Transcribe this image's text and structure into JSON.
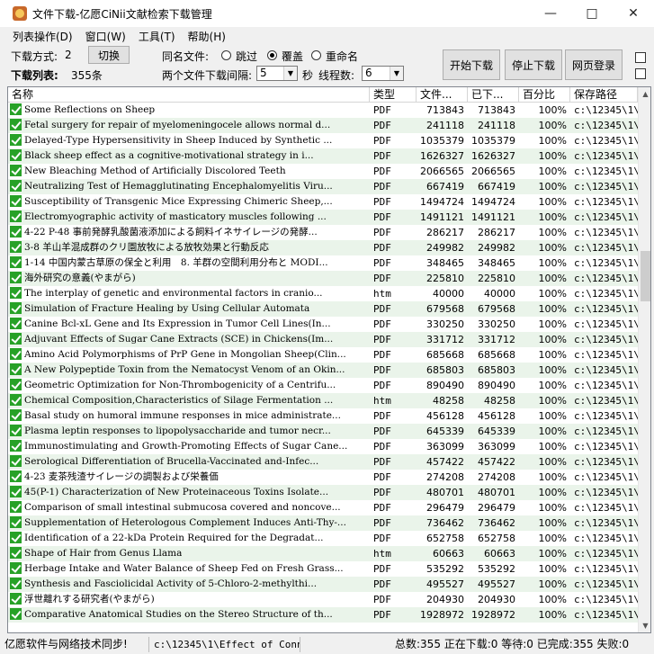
{
  "window": {
    "title": "文件下载-亿愿CiNii文献检索下载管理"
  },
  "menu": [
    "列表操作(D)",
    "窗口(W)",
    "工具(T)",
    "帮助(H)"
  ],
  "toolbar": {
    "download_mode_label": "下载方式:",
    "download_mode_value": "2",
    "switch_button": "切换",
    "download_list_label": "下载列表:",
    "download_list_count": "355条",
    "same_name_label": "同名文件:",
    "opt_skip": "跳过",
    "opt_overwrite": "覆盖",
    "opt_rename": "重命名",
    "interval_label": "两个文件下载间隔:",
    "interval_value": "5",
    "interval_unit": "秒",
    "threads_label": "线程数:",
    "threads_value": "6",
    "start_button": "开始下载",
    "stop_button": "停止下载",
    "login_button": "网页登录"
  },
  "columns": [
    "名称",
    "类型",
    "文件...",
    "已下...",
    "百分比",
    "保存路径"
  ],
  "rows": [
    [
      "Some Reflections on Sheep",
      "PDF",
      "713843",
      "713843",
      "100%",
      "c:\\12345\\1\\"
    ],
    [
      "Fetal surgery for repair of myelomeningocele allows normal d...",
      "PDF",
      "241118",
      "241118",
      "100%",
      "c:\\12345\\1\\"
    ],
    [
      "Delayed-Type Hypersensitivity in Sheep Induced by Synthetic ...",
      "PDF",
      "1035379",
      "1035379",
      "100%",
      "c:\\12345\\1\\"
    ],
    [
      "Black sheep effect as a cognitive-motivational strategy in i...",
      "PDF",
      "1626327",
      "1626327",
      "100%",
      "c:\\12345\\1\\"
    ],
    [
      "New Bleaching Method of Artificially Discolored Teeth",
      "PDF",
      "2066565",
      "2066565",
      "100%",
      "c:\\12345\\1\\"
    ],
    [
      "Neutralizing Test of Hemagglutinating Encephalomyelitis Viru...",
      "PDF",
      "667419",
      "667419",
      "100%",
      "c:\\12345\\1\\"
    ],
    [
      "Susceptibility of Transgenic Mice Expressing Chimeric Sheep,...",
      "PDF",
      "1494724",
      "1494724",
      "100%",
      "c:\\12345\\1\\"
    ],
    [
      "Electromyographic activity of masticatory muscles following ...",
      "PDF",
      "1491121",
      "1491121",
      "100%",
      "c:\\12345\\1\\"
    ],
    [
      "4-22 P-48 事前発酵乳酸菌液添加による飼料イネサイレージの発酵...",
      "PDF",
      "286217",
      "286217",
      "100%",
      "c:\\12345\\1\\"
    ],
    [
      "3-8 羊山羊混成群のクリ園放牧による放牧効果と行動反応",
      "PDF",
      "249982",
      "249982",
      "100%",
      "c:\\12345\\1\\"
    ],
    [
      "1-14 中国内蒙古草原の保全と利用　8. 羊群の空間利用分布と MODI...",
      "PDF",
      "348465",
      "348465",
      "100%",
      "c:\\12345\\1\\"
    ],
    [
      "海外研究の意義(やまがら)",
      "PDF",
      "225810",
      "225810",
      "100%",
      "c:\\12345\\1\\"
    ],
    [
      "The interplay of genetic and environmental factors in cranio...",
      "htm",
      "40000",
      "40000",
      "100%",
      "c:\\12345\\1\\"
    ],
    [
      "Simulation of Fracture Healing by Using Cellular Automata",
      "PDF",
      "679568",
      "679568",
      "100%",
      "c:\\12345\\1\\"
    ],
    [
      "Canine Bcl-xL Gene and Its Expression in Tumor Cell Lines(In...",
      "PDF",
      "330250",
      "330250",
      "100%",
      "c:\\12345\\1\\"
    ],
    [
      "Adjuvant Effects of Sugar Cane Extracts (SCE) in Chickens(Im...",
      "PDF",
      "331712",
      "331712",
      "100%",
      "c:\\12345\\1\\"
    ],
    [
      "Amino Acid Polymorphisms of PrP Gene in Mongolian Sheep(Clin...",
      "PDF",
      "685668",
      "685668",
      "100%",
      "c:\\12345\\1\\"
    ],
    [
      "A New Polypeptide Toxin from the Nematocyst Venom of an Okin...",
      "PDF",
      "685803",
      "685803",
      "100%",
      "c:\\12345\\1\\"
    ],
    [
      "Geometric Optimization for Non-Thrombogenicity of a Centrifu...",
      "PDF",
      "890490",
      "890490",
      "100%",
      "c:\\12345\\1\\"
    ],
    [
      "Chemical Composition,Characteristics of Silage Fermentation ...",
      "htm",
      "48258",
      "48258",
      "100%",
      "c:\\12345\\1\\"
    ],
    [
      "Basal study on humoral immune responses in mice administrate...",
      "PDF",
      "456128",
      "456128",
      "100%",
      "c:\\12345\\1\\"
    ],
    [
      "Plasma leptin responses to lipopolysaccharide and tumor necr...",
      "PDF",
      "645339",
      "645339",
      "100%",
      "c:\\12345\\1\\"
    ],
    [
      "Immunostimulating and Growth-Promoting Effects of Sugar Cane...",
      "PDF",
      "363099",
      "363099",
      "100%",
      "c:\\12345\\1\\"
    ],
    [
      "Serological Differentiation of Brucella-Vaccinated and-Infec...",
      "PDF",
      "457422",
      "457422",
      "100%",
      "c:\\12345\\1\\"
    ],
    [
      "4-23 麦茶残渣サイレージの調製および栄養価",
      "PDF",
      "274208",
      "274208",
      "100%",
      "c:\\12345\\1\\"
    ],
    [
      "45(P-1) Characterization of New Proteinaceous Toxins Isolate...",
      "PDF",
      "480701",
      "480701",
      "100%",
      "c:\\12345\\1\\"
    ],
    [
      "Comparison of small intestinal submucosa covered and noncove...",
      "PDF",
      "296479",
      "296479",
      "100%",
      "c:\\12345\\1\\"
    ],
    [
      "Supplementation of Heterologous Complement Induces Anti-Thy-...",
      "PDF",
      "736462",
      "736462",
      "100%",
      "c:\\12345\\1\\"
    ],
    [
      "Identification of a 22-kDa Protein Required for the Degradat...",
      "PDF",
      "652758",
      "652758",
      "100%",
      "c:\\12345\\1\\"
    ],
    [
      "Shape of Hair from Genus Llama",
      "htm",
      "60663",
      "60663",
      "100%",
      "c:\\12345\\1\\"
    ],
    [
      "Herbage Intake and Water Balance of Sheep Fed on Fresh Grass...",
      "PDF",
      "535292",
      "535292",
      "100%",
      "c:\\12345\\1\\"
    ],
    [
      "Synthesis and Fasciolicidal Activity of 5-Chloro-2-methylthi...",
      "PDF",
      "495527",
      "495527",
      "100%",
      "c:\\12345\\1\\"
    ],
    [
      "浮世離れする研究者(やまがら)",
      "PDF",
      "204930",
      "204930",
      "100%",
      "c:\\12345\\1\\"
    ],
    [
      "Comparative Anatomical Studies on the Stereo Structure of th...",
      "PDF",
      "1928972",
      "1928972",
      "100%",
      "c:\\12345\\1\\"
    ]
  ],
  "status": {
    "company": "亿愿软件与网络技术同步!",
    "current_path": "c:\\12345\\1\\Effect of Conne",
    "summary": "总数:355 正在下载:0 等待:0 已完成:355 失败:0"
  },
  "colors": {
    "check_green": "#27a127",
    "alt_row": "#eaf4ea"
  }
}
